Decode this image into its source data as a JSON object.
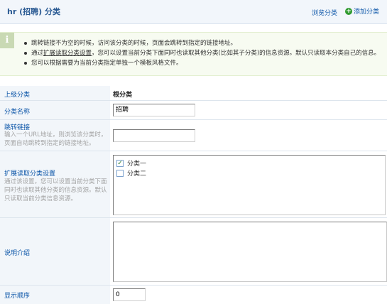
{
  "header": {
    "title": "hr (招聘) 分类",
    "browse_label": "浏览分类",
    "add_label": "添加分类",
    "add_icon": "plus-circle-icon"
  },
  "tips": {
    "icon": "info-icon",
    "line1": "跳转链接不为空的时候，访问该分类的时候，页面会跳转到指定的链接地址。",
    "line2_prefix": "通过",
    "line2_link": "扩展读取分类设置",
    "line2_suffix": "，您可以设置当前分类下面同时也读取其他分类(比如其子分类)的信息资源。默认只读取本分类自己的信息。",
    "line3": "您可以根据需要为当前分类指定单独一个模板风格文件。"
  },
  "form": {
    "parent": {
      "label": "上级分类",
      "value": "根分类"
    },
    "name": {
      "label": "分类名称",
      "value": "招聘"
    },
    "redirect": {
      "label": "跳转链接",
      "desc": "输入一个URL地址，则浏览该分类时，页面自动跳转到指定的链接地址。",
      "value": ""
    },
    "extend": {
      "label": "扩展读取分类设置",
      "desc": "通过该设置，您可以设置当前分类下面同时也读取其他分类的信息资源。默认只读取当前分类信息资源。",
      "options": [
        {
          "label": "分类一",
          "checked": true
        },
        {
          "label": "分类二",
          "checked": false
        }
      ]
    },
    "description": {
      "label": "说明介绍",
      "value": ""
    },
    "order": {
      "label": "显示顺序",
      "value": "0"
    }
  }
}
